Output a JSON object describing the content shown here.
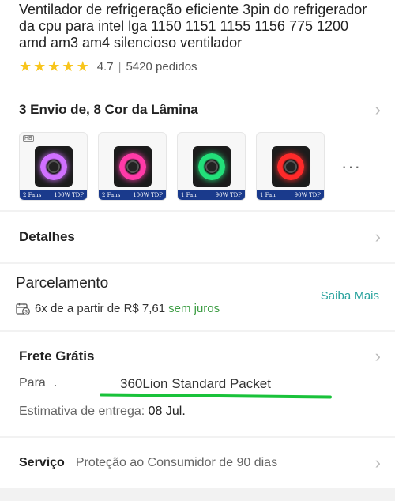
{
  "product": {
    "title": "Ventilador de refrigeração eficiente 3pin do refrigerador da cpu para intel lga 1150 1151 1155 1156 775 1200 amd am3 am4 silencioso ventilador",
    "rating": "4.7",
    "rating_value": 4.7,
    "orders": "5420 pedidos",
    "stars": 5
  },
  "variants": {
    "label": "3 Envio de, 8 Cor da Lâmina",
    "more": "···",
    "items": [
      {
        "fans": "2 Fans",
        "tdp": "100W TDP",
        "ring_color": "#d070ff",
        "brand": "HB"
      },
      {
        "fans": "2 Fans",
        "tdp": "100W TDP",
        "ring_color": "#ff3aa8",
        "brand": ""
      },
      {
        "fans": "1 Fan",
        "tdp": "90W TDP",
        "ring_color": "#22e07a",
        "brand": ""
      },
      {
        "fans": "1 Fan",
        "tdp": "90W TDP",
        "ring_color": "#ff2a2a",
        "brand": ""
      }
    ]
  },
  "details": {
    "label": "Detalhes"
  },
  "installments": {
    "title": "Parcelamento",
    "link": "Saiba Mais",
    "text": "6x de a partir de R$ 7,61",
    "badge": "sem juros"
  },
  "shipping": {
    "label": "Frete Grátis",
    "to_label": "Para",
    "to_value": ".",
    "method": "360Lion Standard Packet",
    "estimate_label": "Estimativa de entrega:",
    "estimate_date": "08 Jul."
  },
  "service": {
    "label": "Serviço",
    "desc": "Proteção ao Consumidor de 90 dias"
  },
  "colors": {
    "accent": "#2aa39e",
    "green": "#3d9d44",
    "star": "#f8c51c",
    "highlight": "#19c23a"
  }
}
